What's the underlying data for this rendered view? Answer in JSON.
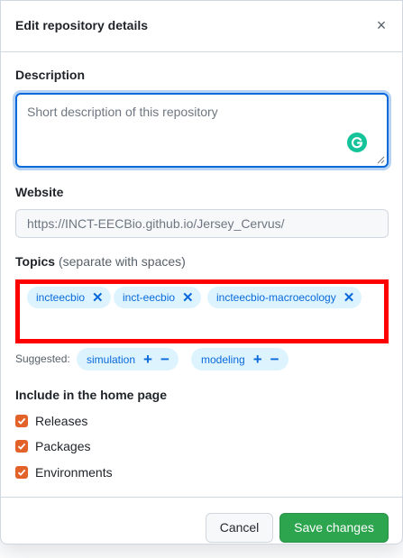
{
  "dialog": {
    "title": "Edit repository details",
    "close_icon": "×"
  },
  "description": {
    "label": "Description",
    "placeholder": "Short description of this repository",
    "grammarly_icon": "grammarly-icon"
  },
  "website": {
    "label": "Website",
    "value": "https://INCT-EECBio.github.io/Jersey_Cervus/"
  },
  "topics": {
    "label": "Topics",
    "note": "(separate with spaces)",
    "items": [
      {
        "label": "incteecbio",
        "remove": "✕"
      },
      {
        "label": "inct-eecbio",
        "remove": "✕"
      },
      {
        "label": "incteecbio-macroecology",
        "remove": "✕"
      }
    ]
  },
  "suggested": {
    "label": "Suggested:",
    "items": [
      {
        "label": "simulation",
        "add": "+",
        "dismiss": "−"
      },
      {
        "label": "modeling",
        "add": "+",
        "dismiss": "−"
      }
    ]
  },
  "home_page": {
    "label": "Include in the home page",
    "options": [
      {
        "label": "Releases",
        "checked": true
      },
      {
        "label": "Packages",
        "checked": true
      },
      {
        "label": "Environments",
        "checked": true
      }
    ]
  },
  "footer": {
    "cancel_label": "Cancel",
    "save_label": "Save changes"
  },
  "colors": {
    "accent": "#0969da",
    "topic_bg": "#ddf4ff",
    "checkbox": "#e2622a",
    "save": "#2da44e",
    "highlight_border": "#ff0000"
  }
}
